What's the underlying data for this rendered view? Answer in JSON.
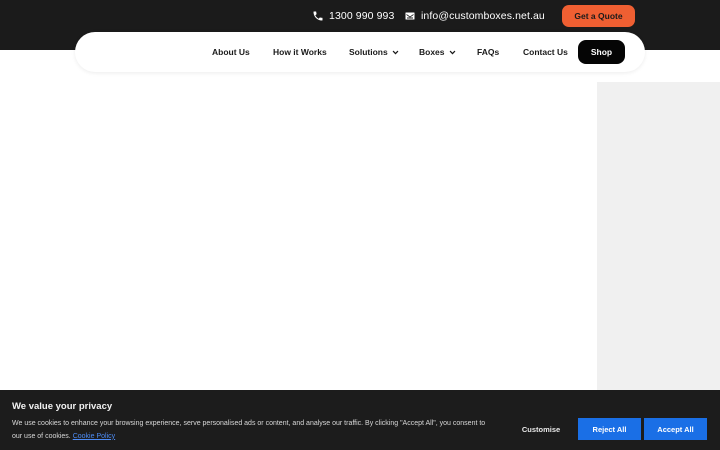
{
  "topbar": {
    "phone": "1300 990 993",
    "email": "info@customboxes.net.au",
    "quote_label": "Get a Quote",
    "phone_icon": "phone-icon",
    "email_icon": "envelope-icon"
  },
  "nav": {
    "items": [
      {
        "label": "About Us"
      },
      {
        "label": "How it Works"
      },
      {
        "label": "Solutions",
        "dropdown": true
      },
      {
        "label": "Boxes",
        "dropdown": true
      },
      {
        "label": "FAQs"
      },
      {
        "label": "Contact Us"
      }
    ],
    "shop_label": "Shop"
  },
  "cookie_banner": {
    "title": "We value your privacy",
    "text": "We use cookies to enhance your browsing experience, serve personalised ads or content, and analyse our traffic. By clicking \"Accept All\", you consent to our use of cookies.",
    "link_label": "Cookie Policy",
    "customise_label": "Customise",
    "reject_label": "Reject All",
    "accept_label": "Accept All"
  },
  "colors": {
    "topbar_bg": "#1b1b1b",
    "quote_button": "#ef5f32",
    "shop_button": "#050505",
    "cookie_button": "#1a6fe6",
    "cookie_link": "#4d8cf5",
    "side_panel": "#f0f0f0"
  }
}
